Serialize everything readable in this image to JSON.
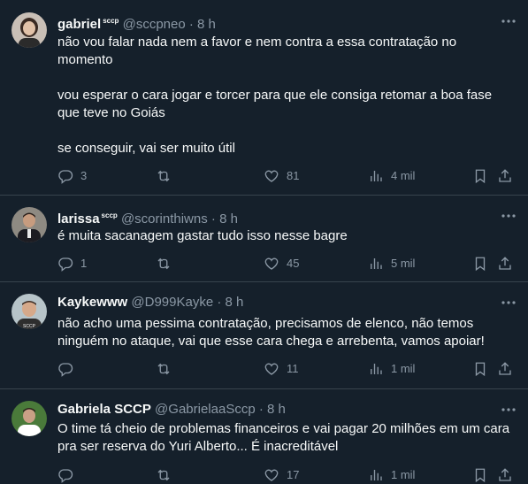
{
  "tweets": [
    {
      "name": "gabriel",
      "tag": "sccp",
      "handle": "@sccpneo",
      "dot": "·",
      "time": "8 h",
      "paragraphs": [
        "não vou falar nada nem a favor e nem contra a essa contratação no momento",
        "vou esperar o cara jogar e torcer para que ele consiga retomar a boa fase que teve no Goiás",
        "se conseguir, vai ser muito útil"
      ],
      "replies": "3",
      "retweets": "",
      "likes": "81",
      "views": "4 mil"
    },
    {
      "name": "larissa",
      "tag": "sccp",
      "handle": "@scorinthiwns",
      "dot": "·",
      "time": "8 h",
      "paragraphs": [
        "é muita sacanagem gastar tudo isso nesse bagre"
      ],
      "replies": "1",
      "retweets": "",
      "likes": "45",
      "views": "5 mil"
    },
    {
      "name": "Kaykewww",
      "tag": "",
      "handle": "@D999Kayke",
      "dot": "·",
      "time": "8 h",
      "paragraphs": [
        "não acho uma pessima contratação, precisamos de elenco, não temos ninguém no ataque, vai que esse cara chega e arrebenta, vamos apoiar!"
      ],
      "replies": "",
      "retweets": "",
      "likes": "11",
      "views": "1 mil"
    },
    {
      "name": "Gabriela SCCP",
      "tag": "",
      "handle": "@GabrielaaSccp",
      "dot": "·",
      "time": "8 h",
      "paragraphs": [
        "O time tá cheio de problemas financeiros e vai pagar 20 milhões em um cara pra ser reserva do Yuri Alberto... É inacreditável"
      ],
      "replies": "",
      "retweets": "",
      "likes": "17",
      "views": "1 mil"
    }
  ],
  "icons": {
    "more": "more-icon",
    "reply": "reply-icon",
    "retweet": "retweet-icon",
    "like": "heart-icon",
    "views": "views-icon",
    "bookmark": "bookmark-icon",
    "share": "share-icon"
  },
  "colors": {
    "background": "#15202b",
    "text": "#f7f9f9",
    "secondary": "#8b98a5",
    "divider": "#38444d"
  }
}
